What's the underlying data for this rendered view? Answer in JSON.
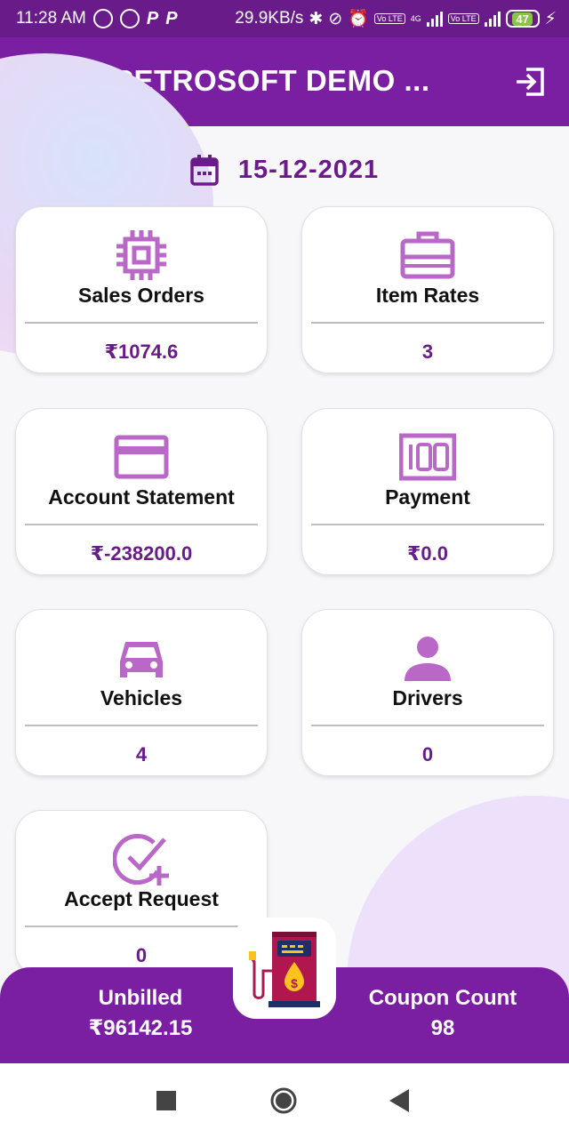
{
  "status_bar": {
    "time": "11:28 AM",
    "net_speed": "29.9KB/s",
    "network": "4G",
    "volte": "Vo LTE",
    "battery": "47"
  },
  "app_bar": {
    "title": "PETROSOFT DEMO ...",
    "menu_icon": "hamburger-menu-icon",
    "logout_icon": "logout-icon"
  },
  "date": {
    "value": "15-12-2021",
    "icon": "calendar-icon"
  },
  "cards": [
    {
      "label": "Sales Orders",
      "value": "₹1074.6",
      "icon": "chip-icon"
    },
    {
      "label": "Item Rates",
      "value": "3",
      "icon": "briefcase-icon"
    },
    {
      "label": "Account Statement",
      "value": "₹-238200.0",
      "icon": "credit-card-icon"
    },
    {
      "label": "Payment",
      "value": "₹0.0",
      "icon": "money-icon"
    },
    {
      "label": "Vehicles",
      "value": "4",
      "icon": "car-icon"
    },
    {
      "label": "Drivers",
      "value": "0",
      "icon": "person-icon"
    },
    {
      "label": "Accept Request",
      "value": "0",
      "icon": "check-plus-icon"
    }
  ],
  "summary": {
    "unbilled_label": "Unbilled",
    "unbilled_value": "₹96142.15",
    "coupon_label": "Coupon Count",
    "coupon_value": "98",
    "center_icon": "fuel-pump-icon"
  },
  "colors": {
    "primary": "#7b1fa2",
    "primary_dark": "#6a1b8a",
    "icon": "#ba68c8"
  }
}
